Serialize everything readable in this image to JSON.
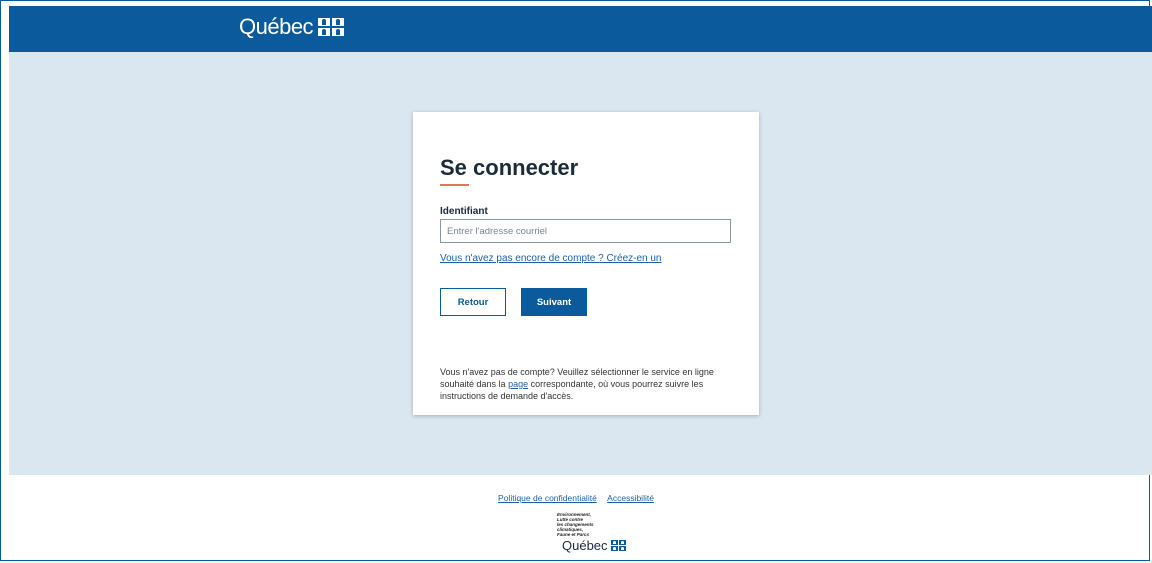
{
  "header": {
    "brand": "Québec"
  },
  "login": {
    "title": "Se connecter",
    "field_label": "Identifiant",
    "input_placeholder": "Entrer l'adresse courriel",
    "input_value": "",
    "create_link": "Vous n'avez pas encore de compte ? Créez-en un",
    "back_button": "Retour",
    "next_button": "Suivant",
    "info_before": "Vous n'avez pas de compte? Veuillez sélectionner le service en ligne souhaité dans la ",
    "info_link": "page",
    "info_after": " correspondante, où vous pourrez suivre les instructions de demande d'accès."
  },
  "footer": {
    "privacy_link": "Politique de confidentialité",
    "accessibility_link": "Accessibilité",
    "dept_lines": [
      "Environnement,",
      "Lutte contre",
      "les changements",
      "climatiques,",
      "Faune et Parcs"
    ],
    "brand": "Québec"
  },
  "colors": {
    "primary": "#0b5a9c",
    "background": "#dbe7f0",
    "accent": "#e0775c"
  }
}
